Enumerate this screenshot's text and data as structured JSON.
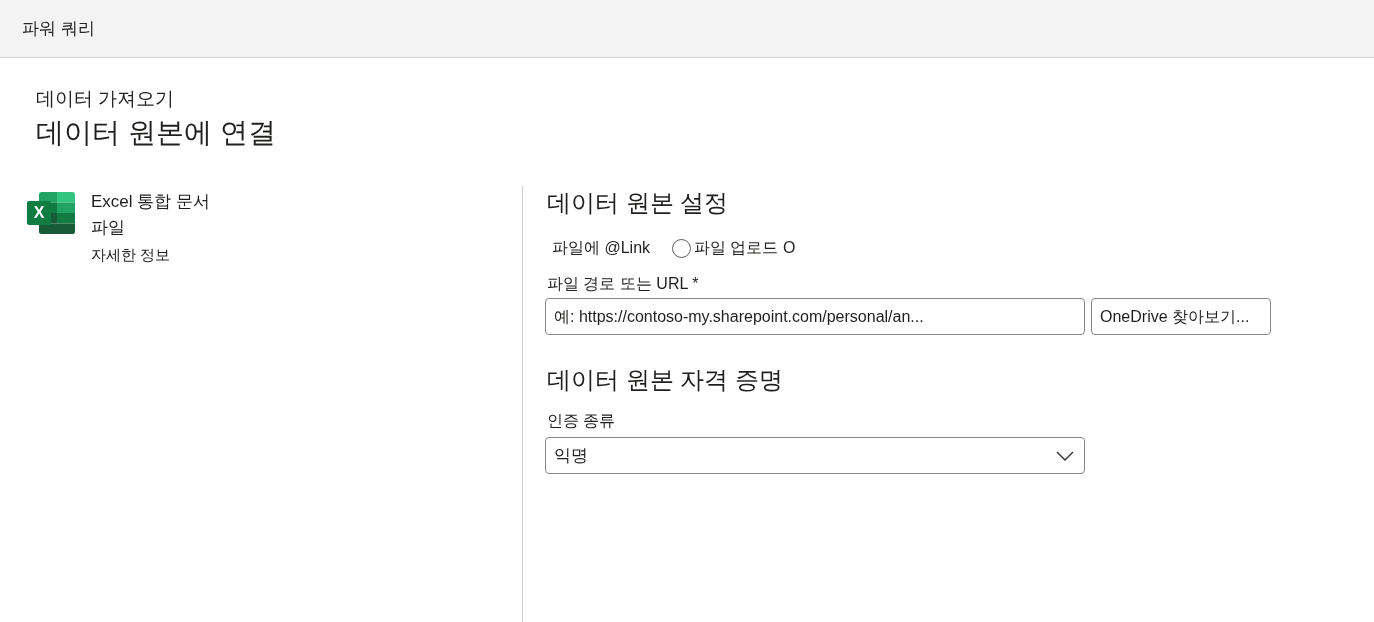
{
  "header": {
    "title": "파워 쿼리"
  },
  "page": {
    "breadcrumb": "데이터 가져오기",
    "title": "데이터 원본에 연결"
  },
  "connector": {
    "logo_letter": "X",
    "name": "Excel 통합 문서",
    "category": "파일",
    "details_link": "자세한 정보"
  },
  "settings": {
    "heading": "데이터 원본 설정",
    "options": [
      {
        "kind": "plain",
        "label": "파일에 @Link"
      },
      {
        "kind": "radio",
        "label": "파일 업로드 O",
        "selected": false
      }
    ],
    "path_field": {
      "label": "파일 경로 또는 URL *",
      "placeholder": "예: https://contoso-my.sharepoint.com/personal/an..."
    },
    "browse_button": "OneDrive 찾아보기..."
  },
  "credentials": {
    "heading": "데이터 원본 자격 증명",
    "auth_field": {
      "label": "인증 종류",
      "value": "익명"
    }
  }
}
